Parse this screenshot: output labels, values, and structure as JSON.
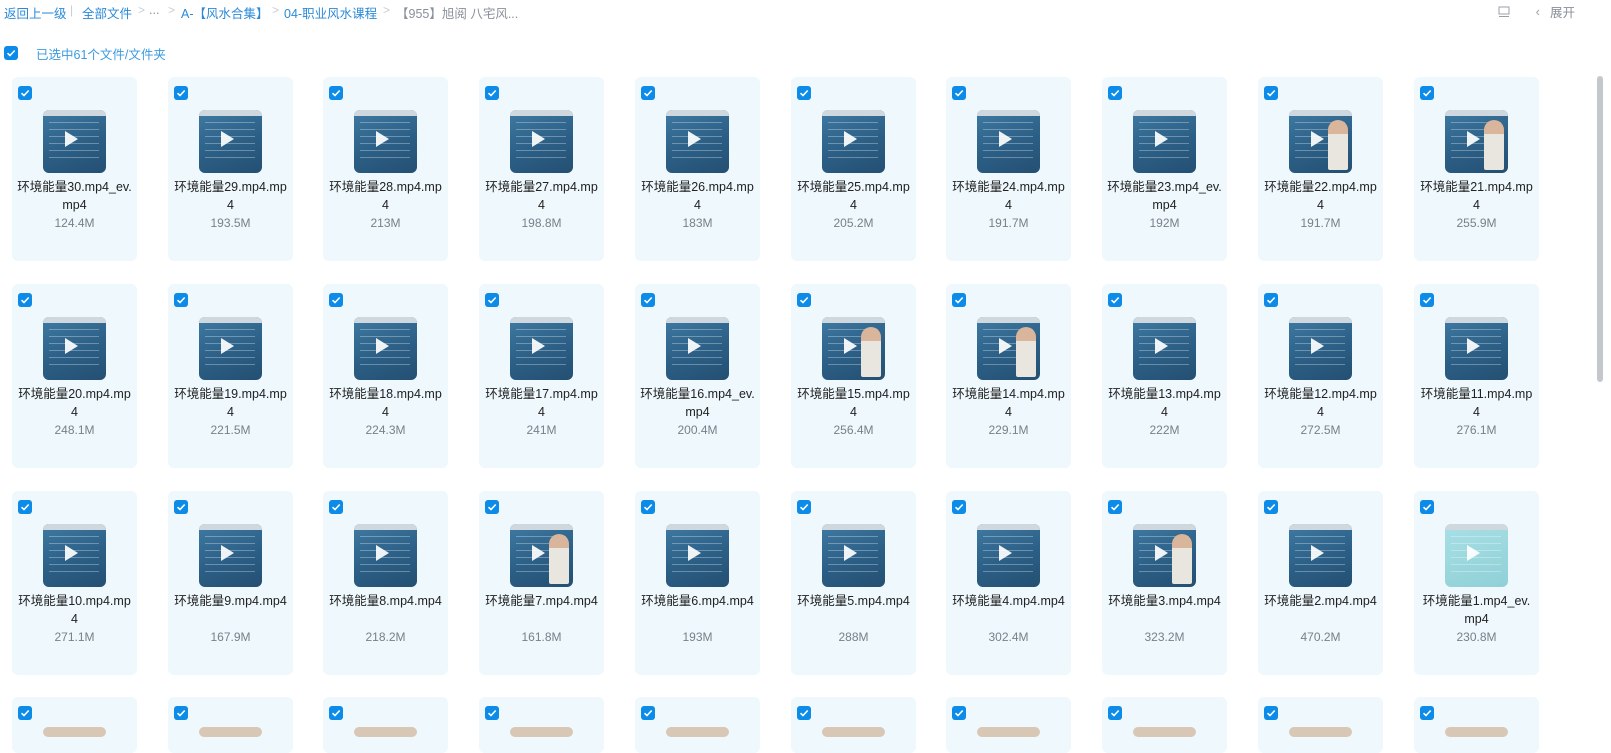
{
  "breadcrumb": {
    "back": "返回上一级",
    "all_files": "全部文件",
    "ellipsis": "...",
    "items": [
      "A-【风水合集】",
      "04-职业风水课程",
      "【955】旭阅 八宅风..."
    ]
  },
  "toolbar": {
    "expand_label": "展开"
  },
  "selection": {
    "label": "已选中61个文件/文件夹"
  },
  "files": [
    {
      "name": "环境能量30.mp4_ev.mp4",
      "size": "124.4M"
    },
    {
      "name": "环境能量29.mp4.mp4",
      "size": "193.5M"
    },
    {
      "name": "环境能量28.mp4.mp4",
      "size": "213M"
    },
    {
      "name": "环境能量27.mp4.mp4",
      "size": "198.8M"
    },
    {
      "name": "环境能量26.mp4.mp4",
      "size": "183M"
    },
    {
      "name": "环境能量25.mp4.mp4",
      "size": "205.2M"
    },
    {
      "name": "环境能量24.mp4.mp4",
      "size": "191.7M"
    },
    {
      "name": "环境能量23.mp4_ev.mp4",
      "size": "192M"
    },
    {
      "name": "环境能量22.mp4.mp4",
      "size": "191.7M"
    },
    {
      "name": "环境能量21.mp4.mp4",
      "size": "255.9M"
    },
    {
      "name": "环境能量20.mp4.mp4",
      "size": "248.1M"
    },
    {
      "name": "环境能量19.mp4.mp4",
      "size": "221.5M"
    },
    {
      "name": "环境能量18.mp4.mp4",
      "size": "224.3M"
    },
    {
      "name": "环境能量17.mp4.mp4",
      "size": "241M"
    },
    {
      "name": "环境能量16.mp4_ev.mp4",
      "size": "200.4M"
    },
    {
      "name": "环境能量15.mp4.mp4",
      "size": "256.4M"
    },
    {
      "name": "环境能量14.mp4.mp4",
      "size": "229.1M"
    },
    {
      "name": "环境能量13.mp4.mp4",
      "size": "222M"
    },
    {
      "name": "环境能量12.mp4.mp4",
      "size": "272.5M"
    },
    {
      "name": "环境能量11.mp4.mp4",
      "size": "276.1M"
    },
    {
      "name": "环境能量10.mp4.mp4",
      "size": "271.1M"
    },
    {
      "name": "环境能量9.mp4.mp4",
      "size": "167.9M"
    },
    {
      "name": "环境能量8.mp4.mp4",
      "size": "218.2M"
    },
    {
      "name": "环境能量7.mp4.mp4",
      "size": "161.8M"
    },
    {
      "name": "环境能量6.mp4.mp4",
      "size": "193M"
    },
    {
      "name": "环境能量5.mp4.mp4",
      "size": "288M"
    },
    {
      "name": "环境能量4.mp4.mp4",
      "size": "302.4M"
    },
    {
      "name": "环境能量3.mp4.mp4",
      "size": "323.2M"
    },
    {
      "name": "环境能量2.mp4.mp4",
      "size": "470.2M"
    },
    {
      "name": "环境能量1.mp4_ev.mp4",
      "size": "230.8M"
    }
  ],
  "icons": {
    "checkbox": "checkbox-checked-icon",
    "play": "play-icon",
    "layout": "layout-toggle-icon",
    "chevron": "chevron-left-icon"
  },
  "colors": {
    "accent": "#0d8be8",
    "card_bg": "#eef8fd",
    "link": "#2a8ad8"
  }
}
